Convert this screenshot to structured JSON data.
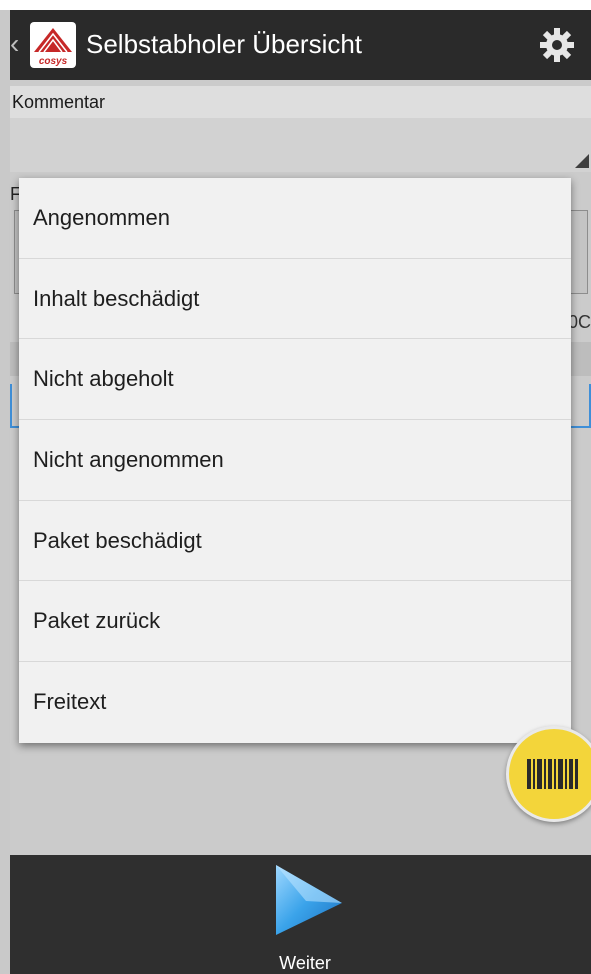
{
  "header": {
    "title": "Selbstabholer Übersicht",
    "logo_text": "cosys",
    "icons": {
      "back": "chevron-left-icon",
      "logo": "app-logo-icon",
      "settings": "gear-icon"
    }
  },
  "form": {
    "kommentar_label": "Kommentar",
    "partial_label": "F",
    "counter_text": "0C"
  },
  "dropdown": {
    "items": [
      {
        "label": "Angenommen"
      },
      {
        "label": "Inhalt beschädigt"
      },
      {
        "label": "Nicht abgeholt"
      },
      {
        "label": "Nicht angenommen"
      },
      {
        "label": "Paket beschädigt"
      },
      {
        "label": "Paket zurück"
      },
      {
        "label": "Freitext"
      }
    ]
  },
  "fab": {
    "icon": "barcode-icon"
  },
  "footer": {
    "weiter_label": "Weiter",
    "icon": "play-arrow-icon"
  },
  "colors": {
    "action_bar": "#2a2a2a",
    "accent_blue": "#3f8fd8",
    "fab_yellow": "#f3d53a",
    "logo_red": "#c62828"
  }
}
